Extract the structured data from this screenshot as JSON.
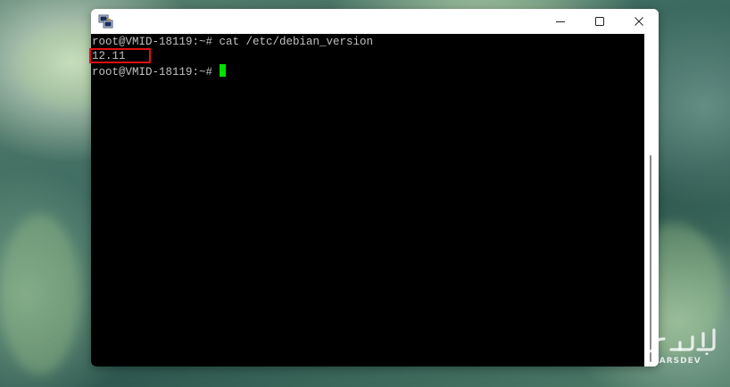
{
  "terminal": {
    "lines": [
      {
        "prompt": "root@VMID-18119:~#",
        "command": " cat /etc/debian_version"
      },
      {
        "output": "12.11"
      },
      {
        "prompt": "root@VMID-18119:~#",
        "command": " "
      }
    ]
  },
  "window": {
    "minimize_icon": "minimize-icon",
    "maximize_icon": "maximize-icon",
    "close_icon": "close-icon",
    "app_icon": "putty-icon"
  },
  "annotation": {
    "highlight_color": "#e01010"
  },
  "watermark": {
    "brand_text": "PARSDEV",
    "logo_text": "پارسـ"
  },
  "colors": {
    "terminal_bg": "#000000",
    "terminal_fg": "#c0c0c0",
    "cursor": "#00e000"
  }
}
